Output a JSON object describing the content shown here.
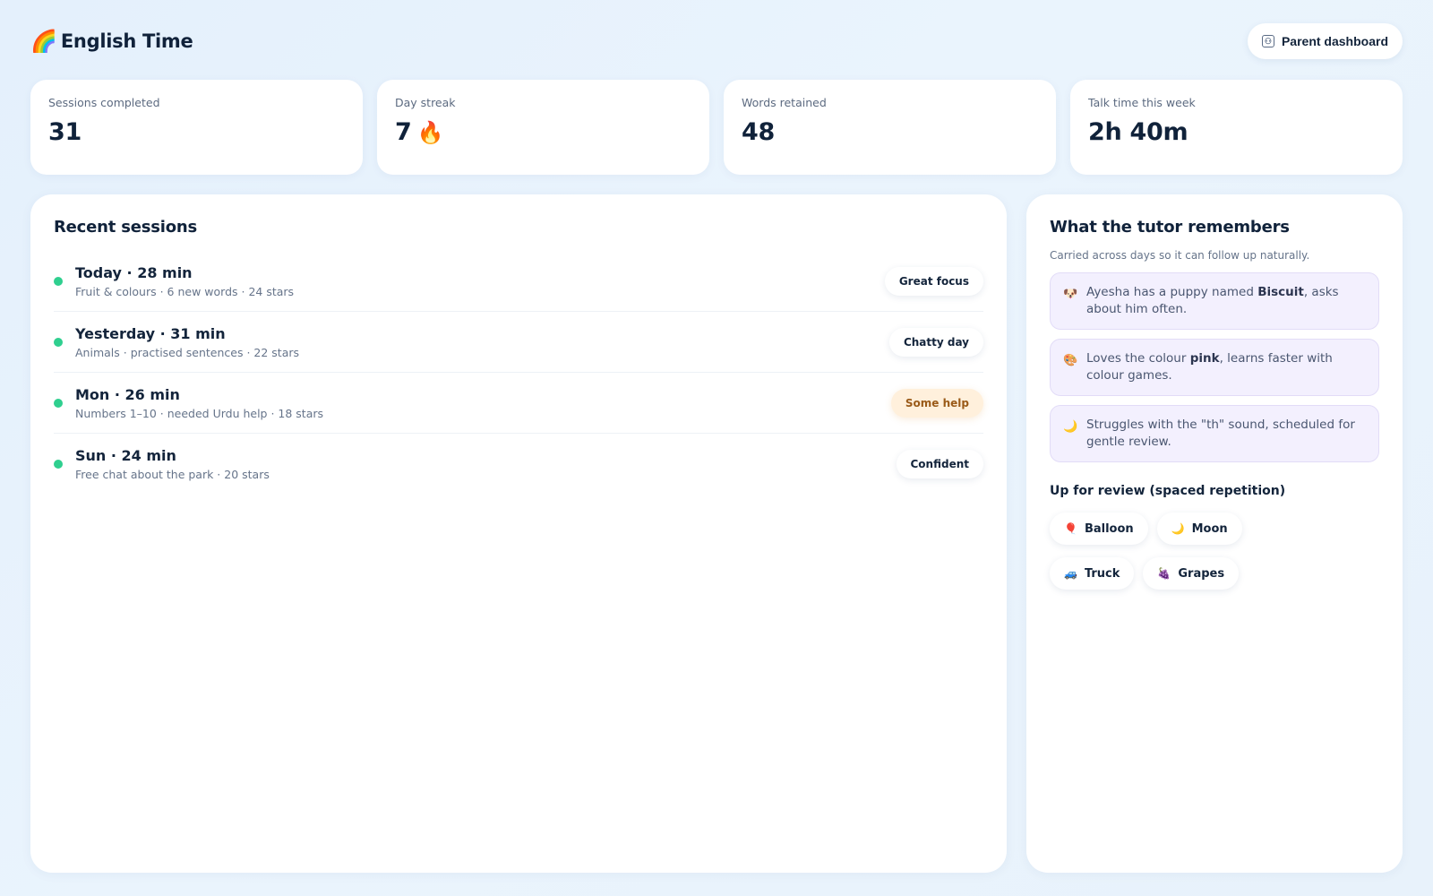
{
  "app": {
    "logo_emoji": "🌈",
    "title": "English Time",
    "parent_button": "Parent dashboard",
    "parent_icon": "dashboard-icon"
  },
  "stats": [
    {
      "label": "Sessions completed",
      "value": "31"
    },
    {
      "label": "Day streak",
      "value": "7",
      "emoji": "🔥"
    },
    {
      "label": "Words retained",
      "value": "48"
    },
    {
      "label": "Talk time this week",
      "value": "2h 40m"
    }
  ],
  "sessions": {
    "heading": "Recent sessions",
    "items": [
      {
        "title": "Today · 28 min",
        "subtitle": "Fruit & colours · 6 new words · 24 stars",
        "tag": "Great focus"
      },
      {
        "title": "Yesterday · 31 min",
        "subtitle": "Animals · practised sentences · 22 stars",
        "tag": "Chatty day"
      },
      {
        "title": "Mon · 26 min",
        "subtitle": "Numbers 1–10 · needed Urdu help · 18 stars",
        "tag": "Some help"
      },
      {
        "title": "Sun · 24 min",
        "subtitle": "Free chat about the park · 20 stars",
        "tag": "Confident"
      }
    ],
    "dot_color": "#2fcf8f",
    "warn_tag_color": "#fff0dc"
  },
  "memory": {
    "heading": "What the tutor remembers",
    "subheading": "Carried across days so it can follow up naturally.",
    "items": [
      {
        "icon": "🐶",
        "before": "Ayesha has a puppy named ",
        "bold": "Biscuit",
        "after": ", asks about him often."
      },
      {
        "icon": "🎨",
        "before": "Loves the colour ",
        "bold": "pink",
        "after": ", learns faster with colour games."
      },
      {
        "icon": "🌙",
        "before": "Struggles with the \"th\" sound, scheduled for gentle review.",
        "bold": "",
        "after": ""
      }
    ],
    "review_heading": "Up for review (spaced repetition)",
    "review_words": [
      {
        "icon": "🎈",
        "word": "Balloon"
      },
      {
        "icon": "🌙",
        "word": "Moon"
      },
      {
        "icon": "🚙",
        "word": "Truck"
      },
      {
        "icon": "🍇",
        "word": "Grapes"
      }
    ]
  }
}
